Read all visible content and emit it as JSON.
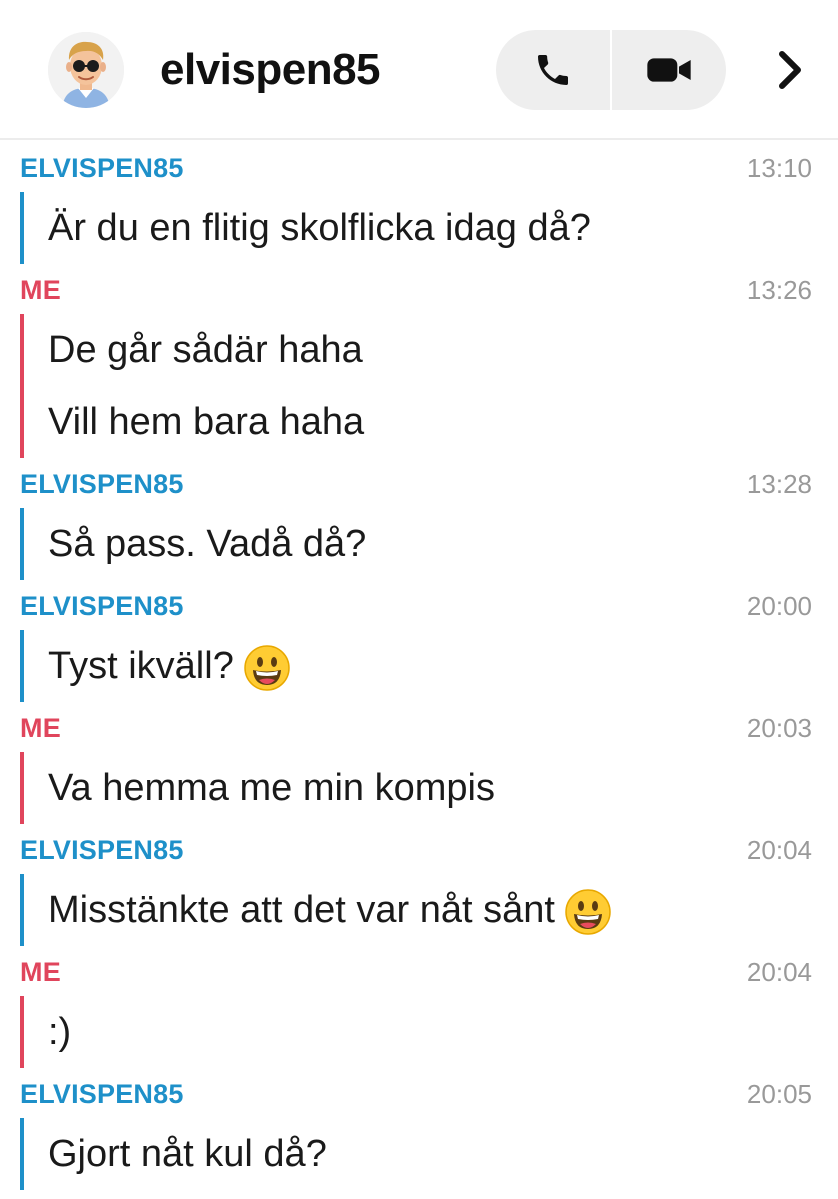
{
  "header": {
    "username": "elvispen85",
    "avatar_icon": "bitmoji-avatar-icon",
    "call_icon": "phone-icon",
    "video_icon": "video-camera-icon",
    "more_icon": "chevron-right-icon"
  },
  "colors": {
    "them": "#1e90c9",
    "me": "#e0455c",
    "timestamp": "#999999"
  },
  "messages": [
    {
      "sender": "ELVISPEN85",
      "from": "them",
      "time": "13:10",
      "lines": [
        {
          "text": "Är du en flitig skolflicka idag då?",
          "emoji": ""
        }
      ]
    },
    {
      "sender": "ME",
      "from": "me",
      "time": "13:26",
      "lines": [
        {
          "text": "De går sådär haha",
          "emoji": ""
        },
        {
          "text": "Vill hem bara haha",
          "emoji": ""
        }
      ]
    },
    {
      "sender": "ELVISPEN85",
      "from": "them",
      "time": "13:28",
      "lines": [
        {
          "text": "Så pass. Vadå då?",
          "emoji": ""
        }
      ]
    },
    {
      "sender": "ELVISPEN85",
      "from": "them",
      "time": "20:00",
      "lines": [
        {
          "text": "Tyst ikväll?",
          "emoji": "grinning-face-emoji"
        }
      ]
    },
    {
      "sender": "ME",
      "from": "me",
      "time": "20:03",
      "lines": [
        {
          "text": "Va hemma me min kompis",
          "emoji": ""
        }
      ]
    },
    {
      "sender": "ELVISPEN85",
      "from": "them",
      "time": "20:04",
      "lines": [
        {
          "text": "Misstänkte att det var nåt sånt",
          "emoji": "grinning-face-emoji"
        }
      ]
    },
    {
      "sender": "ME",
      "from": "me",
      "time": "20:04",
      "lines": [
        {
          "text": ":)",
          "emoji": ""
        }
      ]
    },
    {
      "sender": "ELVISPEN85",
      "from": "them",
      "time": "20:05",
      "lines": [
        {
          "text": "Gjort nåt kul då?",
          "emoji": ""
        }
      ]
    }
  ]
}
